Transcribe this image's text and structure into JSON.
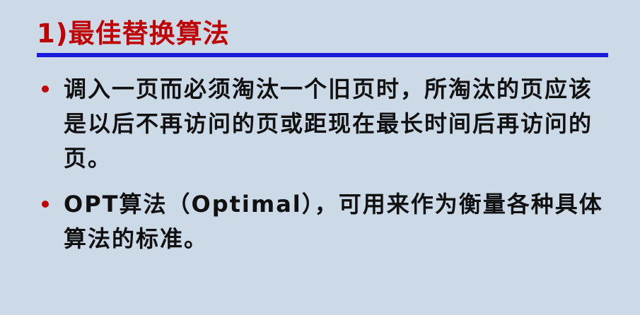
{
  "slide": {
    "title": "1)最佳替换算法",
    "colors": {
      "background": "#ccd9e6",
      "title": "#c00000",
      "rule": "#1a1adc",
      "bullet": "#c00000",
      "text": "#111111"
    },
    "bullets": [
      {
        "text": "调入一页而必须淘汰一个旧页时，所淘汰的页应该是以后不再访问的页或距现在最长时间后再访问的页。"
      },
      {
        "text": "OPT算法（Optimal），可用来作为衡量各种具体算法的标准。"
      }
    ]
  }
}
